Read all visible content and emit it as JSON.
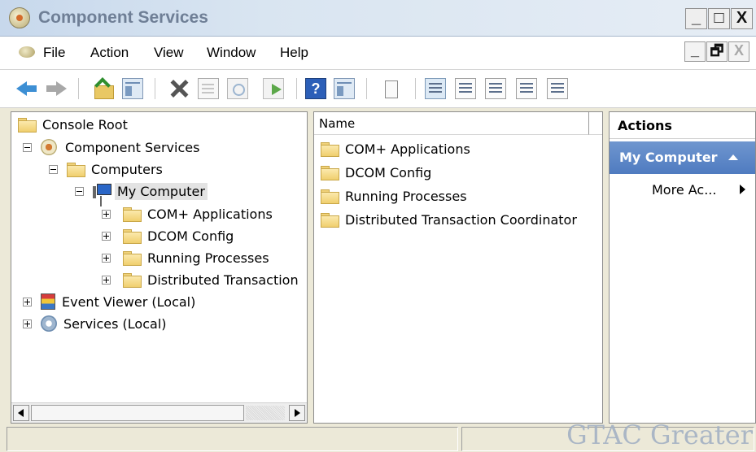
{
  "window": {
    "title": "Component Services",
    "title_buttons": {
      "minimize": "_",
      "maximize": "□",
      "close": "X"
    }
  },
  "menubar": {
    "items": [
      "File",
      "Action",
      "View",
      "Window",
      "Help"
    ],
    "mdi_buttons": {
      "minimize": "_",
      "restore": "🗗",
      "close": "X"
    }
  },
  "toolbar": {
    "icons": [
      "back-arrow-icon",
      "forward-arrow-icon",
      "up-folder-icon",
      "show-hide-console-tree-icon",
      "delete-icon",
      "properties-icon",
      "refresh-icon",
      "export-list-icon",
      "help-icon",
      "show-hide-action-pane-icon",
      "new-window-icon",
      "large-icons-icon",
      "small-icons-icon",
      "list-icon",
      "detail-icon",
      "status-view-icon"
    ]
  },
  "tree": {
    "items": [
      {
        "label": "Console Root",
        "icon": "folder-icon",
        "expander": ""
      },
      {
        "label": "Component Services",
        "icon": "component-services-icon",
        "expander": "minus"
      },
      {
        "label": "Computers",
        "icon": "folder-icon",
        "expander": "minus"
      },
      {
        "label": "My Computer",
        "icon": "computer-icon",
        "expander": "minus",
        "selected": true
      },
      {
        "label": "COM+ Applications",
        "icon": "folder-icon",
        "expander": "plus"
      },
      {
        "label": "DCOM Config",
        "icon": "folder-icon",
        "expander": "plus"
      },
      {
        "label": "Running Processes",
        "icon": "folder-icon",
        "expander": "plus"
      },
      {
        "label": "Distributed Transaction",
        "icon": "folder-icon",
        "expander": "plus"
      },
      {
        "label": "Event Viewer (Local)",
        "icon": "event-viewer-icon",
        "expander": "plus"
      },
      {
        "label": "Services (Local)",
        "icon": "services-icon",
        "expander": "plus"
      }
    ]
  },
  "list": {
    "column_header": "Name",
    "items": [
      "COM+ Applications",
      "DCOM Config",
      "Running Processes",
      "Distributed Transaction Coordinator"
    ]
  },
  "actions": {
    "header": "Actions",
    "group_title": "My Computer",
    "items": [
      "More Ac..."
    ]
  },
  "statusbar": {
    "watermark": "GTAC Greater"
  },
  "colors": {
    "action_group_bg": "#5a84c5",
    "title_text": "#6f7f96",
    "folder": "#f0cf6e"
  }
}
